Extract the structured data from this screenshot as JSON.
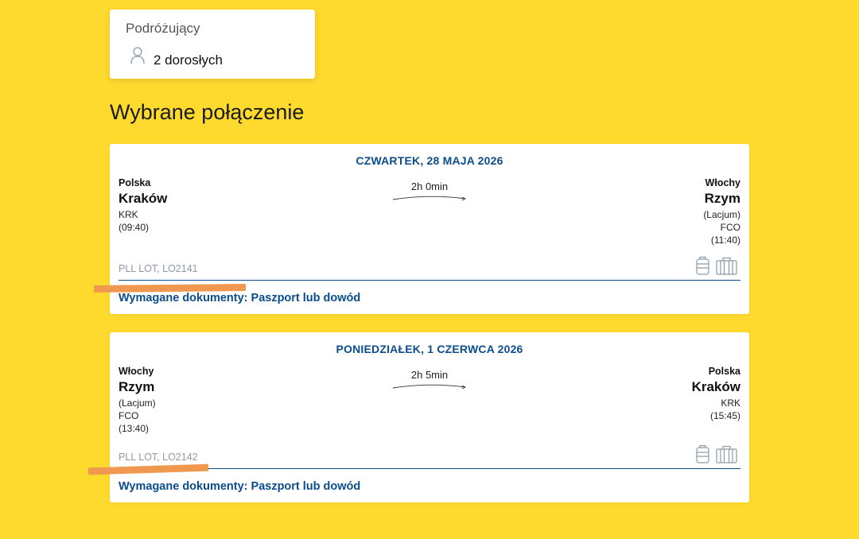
{
  "travellers": {
    "label": "Podróżujący",
    "count": "2 dorosłych"
  },
  "section_title": "Wybrane połączenie",
  "flights": [
    {
      "date": "CZWARTEK, 28 MAJA 2026",
      "duration": "2h 0min",
      "departure": {
        "country": "Polska",
        "city": "Kraków",
        "region": "",
        "code": "KRK",
        "time": "(09:40)"
      },
      "arrival": {
        "country": "Włochy",
        "city": "Rzym",
        "region": "(Lacjum)",
        "code": "FCO",
        "time": "(11:40)"
      },
      "flight_number": "PLL LOT, LO2141",
      "documents": "Wymagane dokumenty: Paszport lub dowód"
    },
    {
      "date": "PONIEDZIAŁEK, 1 CZERWCA 2026",
      "duration": "2h 5min",
      "departure": {
        "country": "Włochy",
        "city": "Rzym",
        "region": "(Lacjum)",
        "code": "FCO",
        "time": "(13:40)"
      },
      "arrival": {
        "country": "Polska",
        "city": "Kraków",
        "region": "",
        "code": "KRK",
        "time": "(15:45)"
      },
      "flight_number": "PLL LOT, LO2142",
      "documents": "Wymagane dokumenty: Paszport lub dowód"
    }
  ],
  "colors": {
    "background": "#ffda2e",
    "accent": "#0b4d8c",
    "highlight": "#f0984f"
  },
  "icons": [
    "person-icon",
    "flight-arc-arrow-icon",
    "cabin-bag-icon",
    "suitcase-icon"
  ]
}
